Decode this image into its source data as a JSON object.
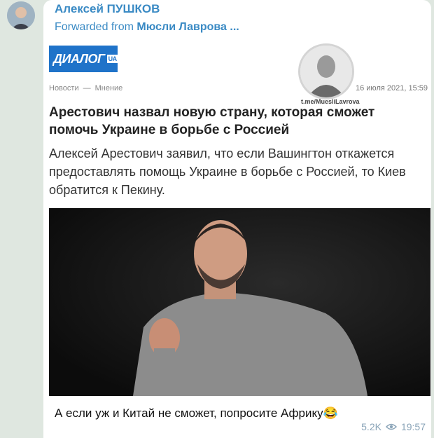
{
  "message": {
    "sender": "Алексей ПУШКОВ",
    "forward_prefix": "Forwarded from",
    "forward_source": "Мюсли Лаврова ...",
    "caption": "А если уж и Китай не сможет, попросите Африку😂",
    "views": "5.2K",
    "time": "19:57"
  },
  "article": {
    "logo_text": "ДИАЛОГ",
    "logo_suffix": "UA",
    "breadcrumb_1": "Новости",
    "breadcrumb_sep": "—",
    "breadcrumb_2": "Мнение",
    "stamp_caption": "t.me/MuesliLavrova",
    "date": "16 июля 2021, 15:59",
    "headline": "Арестович назвал новую страну, которая сможет помочь Украине в борьбе с Россией",
    "lead": "Алексей Арестович заявил, что если Вашингтон откажется предоставлять помощь Украине в борьбе с Россией, то Киев обратится к Пекину."
  },
  "colors": {
    "sender": "#3a8ac4",
    "logo_bg": "#1f73c9",
    "meta": "#8aa4b8"
  }
}
